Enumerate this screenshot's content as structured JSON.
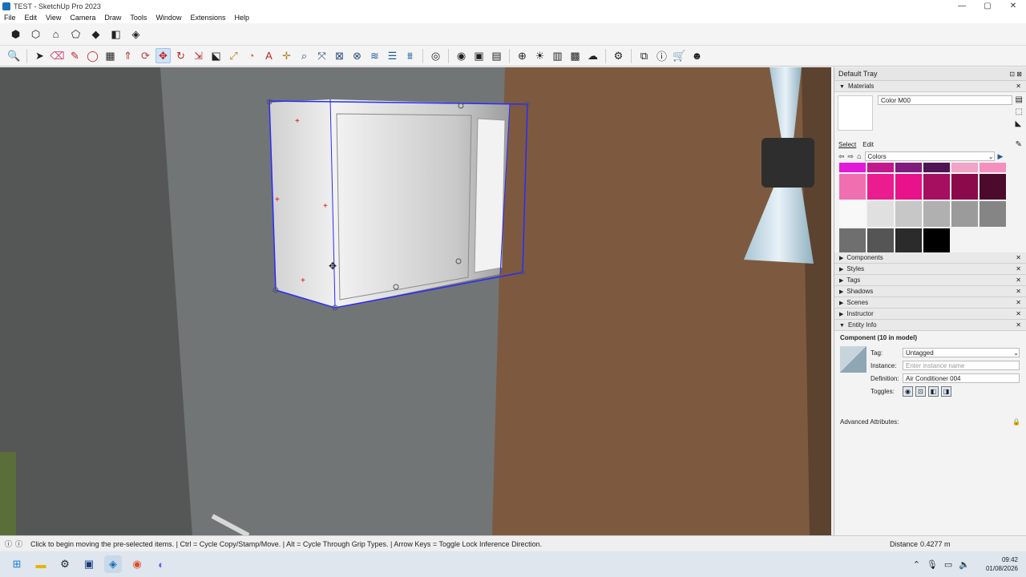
{
  "window": {
    "title": "TEST - SketchUp Pro 2023",
    "minimize": "—",
    "maximize": "▢",
    "close": "✕"
  },
  "menu": [
    "File",
    "Edit",
    "View",
    "Camera",
    "Draw",
    "Tools",
    "Window",
    "Extensions",
    "Help"
  ],
  "toolbar1_icons": [
    "iso-view-icon",
    "top-view-icon",
    "front-view-icon",
    "right-view-icon",
    "back-view-icon",
    "left-view-icon",
    "bottom-view-icon"
  ],
  "toolbar2_icons": [
    "zoom-icon",
    "select-icon",
    "eraser-icon",
    "pencil-icon",
    "shapes-icon",
    "paint-bucket-icon",
    "push-pull-icon",
    "follow-me-icon",
    "move-icon",
    "rotate-icon",
    "scale-icon",
    "offset-icon",
    "tape-measure-icon",
    "protractor-icon",
    "text-icon",
    "axes-icon",
    "orbit-icon",
    "pan-icon",
    "zoom-window-icon",
    "zoom-extents-icon",
    "section-plane-icon",
    "layers-icon",
    "styles-icon",
    "account-icon",
    "warehouse-icon",
    "extension-icon",
    "location-icon",
    "sandbox-icon",
    "cloud-icon",
    "settings-icon",
    "frame-icon",
    "info-icon",
    "cart-icon",
    "user-icon"
  ],
  "tray": {
    "title": "Default Tray",
    "materials": {
      "panel_title": "Materials",
      "material_name": "Color M00",
      "tabs": [
        "Select",
        "Edit"
      ],
      "library": "Colors",
      "swatches": [
        "#e21ad8",
        "#c2188d",
        "#7f1c7e",
        "#4e1456",
        "#f0a4c8",
        "#f58fc0",
        "#f06fb0",
        "#ea1c8f",
        "#e8128a",
        "#a60e5f",
        "#8a0a4c",
        "#4c0a2c",
        "#f8f8f8",
        "#e0e0e0",
        "#c7c7c7",
        "#b0b0b0",
        "#9b9b9b",
        "#858585",
        "#6f6f6f",
        "#555555",
        "#2b2b2b",
        "#000000"
      ]
    },
    "panels": [
      "Components",
      "Styles",
      "Tags",
      "Shadows",
      "Scenes",
      "Instructor",
      "Entity Info"
    ],
    "entity_info": {
      "heading": "Component (10 in model)",
      "tag_label": "Tag:",
      "tag_value": "Untagged",
      "instance_label": "Instance:",
      "instance_placeholder": "Enter instance name",
      "definition_label": "Definition:",
      "definition_value": "Air Conditioner 004",
      "toggles_label": "Toggles:",
      "advanced": "Advanced Attributes:"
    }
  },
  "status": {
    "message": "Click to begin moving the pre-selected items.  |  Ctrl = Cycle Copy/Stamp/Move.  |  Alt = Cycle Through Grip Types.  |  Arrow Keys = Toggle Lock Inference Direction.",
    "distance_label": "Distance",
    "distance_value": "0.4277 m"
  },
  "taskbar": {
    "time": "09:42",
    "date": "01/08/2026"
  }
}
